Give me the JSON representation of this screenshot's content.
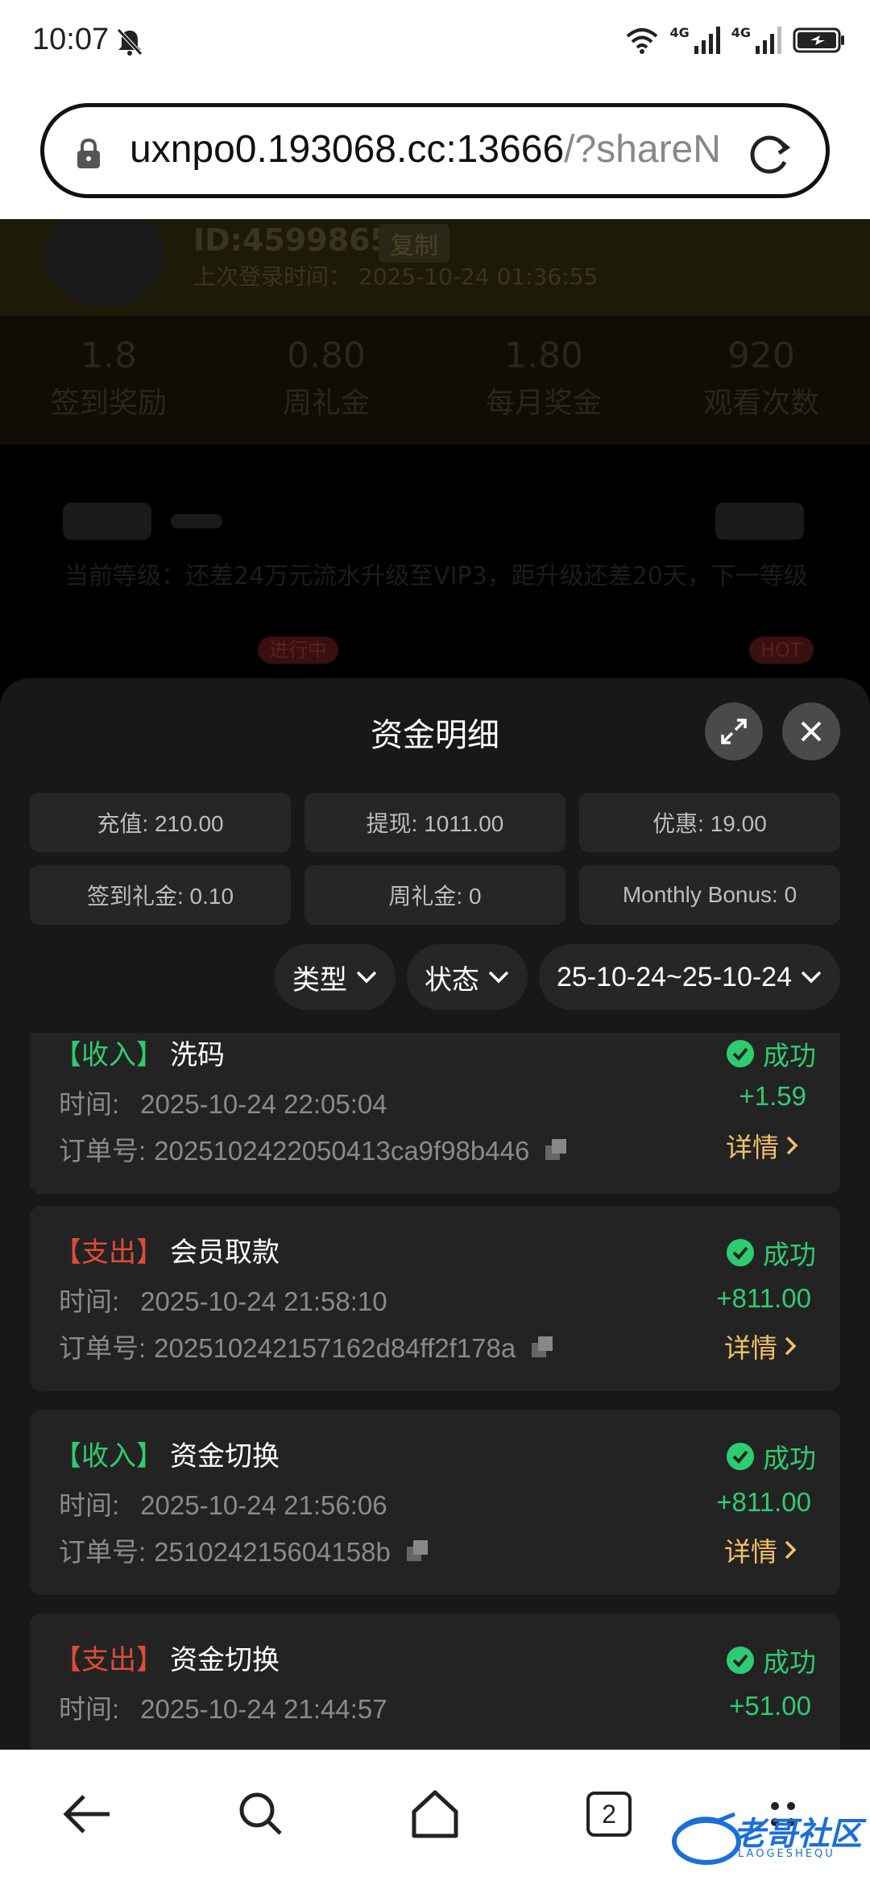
{
  "status_bar": {
    "time": "10:07",
    "network_1": "4G",
    "network_2": "4G"
  },
  "browser": {
    "url_main": "uxnpo0.193068.cc:13666",
    "url_rest": "/?shareN"
  },
  "background_page": {
    "user_id": "ID:4599865",
    "copy_label": "复制",
    "last_login": "上次登录时间： 2025-10-24 01:36:55",
    "stats": [
      {
        "value": "1.8",
        "label": "签到奖励"
      },
      {
        "value": "0.80",
        "label": "周礼金"
      },
      {
        "value": "1.80",
        "label": "每月奖金"
      },
      {
        "value": "920",
        "label": "观看次数"
      }
    ],
    "level_text": "当前等级：还差24万元流水升级至VIP3，距升级还差20天，下一等级",
    "badges": [
      "进行中",
      "HOT"
    ]
  },
  "modal": {
    "title": "资金明细",
    "summary": [
      "充值: 210.00",
      "提现: 1011.00",
      "优惠: 19.00",
      "签到礼金: 0.10",
      "周礼金: 0",
      "Monthly Bonus: 0"
    ],
    "filters": {
      "type": "类型",
      "status": "状态",
      "date_range": "25-10-24~25-10-24"
    },
    "labels": {
      "time": "时间:",
      "order": "订单号:",
      "detail": "详情"
    },
    "records": [
      {
        "tag": "【收入】",
        "kind": "in",
        "name": "洗码",
        "time": "2025-10-24 22:05:04",
        "order": "202510242205041 3ca9f98b446",
        "status": "成功",
        "amount": "+1.59"
      },
      {
        "tag": "【支出】",
        "kind": "out",
        "name": "会员取款",
        "time": "2025-10-24 21:58:10",
        "order": "202510242157162d84ff2f178a",
        "status": "成功",
        "amount": "+811.00"
      },
      {
        "tag": "【收入】",
        "kind": "in",
        "name": "资金切换",
        "time": "2025-10-24 21:56:06",
        "order": "251024215604158b",
        "status": "成功",
        "amount": "+811.00"
      },
      {
        "tag": "【支出】",
        "kind": "out",
        "name": "资金切换",
        "time": "2025-10-24 21:44:57",
        "order": "",
        "status": "成功",
        "amount": "+51.00"
      }
    ]
  },
  "bottom_nav": {
    "tab_count": "2",
    "watermark": "老哥社区",
    "watermark_sub": "LAOGESHEQU"
  },
  "colors": {
    "income": "#2ecc71",
    "expense": "#e04b3a",
    "detail": "#f2c066"
  }
}
